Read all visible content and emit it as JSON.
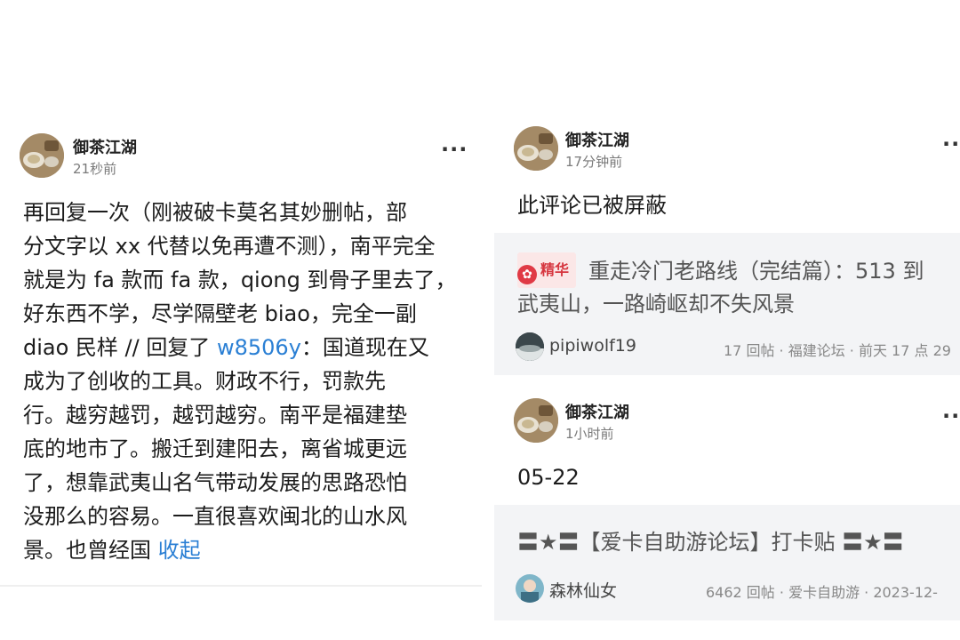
{
  "left": {
    "user": "御茶江湖",
    "time": "21秒前",
    "more": "···",
    "lines": [
      "再回复一次（刚被破卡莫名其妙删帖，部",
      "分文字以 xx 代替以免再遭不测），南平完全",
      "就是为 fa 款而 fa 款，qiong 到骨子里去了，",
      "好东西不学，尽学隔壁老 biao，完全一副",
      "diao 民样 // 回复了 ",
      "成为了创收的工具。财政不行，罚款先",
      "行。越穷越罚，越罚越穷。南平是福建垫",
      "底的地市了。搬迁到建阳去，离省城更远",
      "了，想靠武夷山名气带动发展的思路恐怕",
      "没那么的容易。一直很喜欢闽北的山水风",
      "景。也曾经国 "
    ],
    "reply_user": "w8506y",
    "reply_tail": "：国道现在又",
    "collapse": "收起"
  },
  "right": {
    "comment1": {
      "user": "御茶江湖",
      "time": "17分钟前",
      "more": "··",
      "text": "此评论已被屏蔽"
    },
    "card1": {
      "tag": "精华",
      "title_line1": "重走冷门老路线（完结篇）：513 到",
      "title_line2": "武夷山，一路崎岖却不失风景",
      "author": "pipiwolf19",
      "meta": "17 回帖 · 福建论坛 · 前天 17 点 29"
    },
    "comment2": {
      "user": "御茶江湖",
      "time": "1小时前",
      "more": "··",
      "text": "05-22"
    },
    "card2": {
      "title": "〓★〓【爱卡自助游论坛】打卡贴 〓★〓",
      "author": "森林仙女",
      "meta": "6462 回帖 · 爱卡自助游 · 2023-12-"
    }
  },
  "colors": {
    "link": "#2a7fd4",
    "tag_red": "#d6363f",
    "card_bg": "#f3f4f6"
  }
}
